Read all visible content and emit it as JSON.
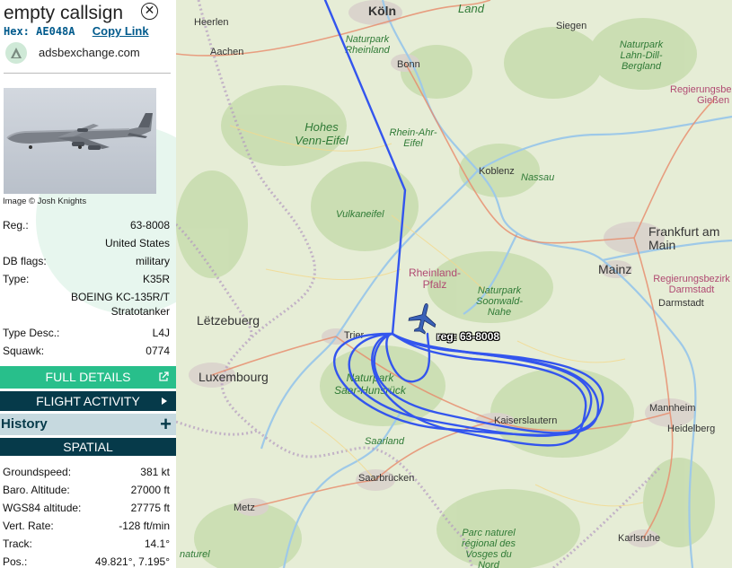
{
  "aircraft": {
    "callsign": "empty callsign",
    "hex_label": "Hex:",
    "hex": "AE048A",
    "copy_link": "Copy Link",
    "site": "adsbexchange.com",
    "image_credit": "Image © Josh Knights"
  },
  "details": [
    {
      "key": "Reg.:",
      "value": "63-8008"
    },
    {
      "key": "",
      "value": "United States"
    },
    {
      "key": "DB flags:",
      "value": "military"
    },
    {
      "key": "Type:",
      "value": "K35R"
    },
    {
      "key": "",
      "value": "BOEING KC-135R/T"
    },
    {
      "key": "",
      "value": "Stratotanker"
    },
    {
      "key": "Type Desc.:",
      "value": "L4J"
    },
    {
      "key": "Squawk:",
      "value": "0774"
    }
  ],
  "buttons": {
    "full_details": "FULL DETAILS",
    "flight_activity": "FLIGHT ACTIVITY",
    "history": "History",
    "spatial": "SPATIAL"
  },
  "spatial": [
    {
      "key": "Groundspeed:",
      "value": "381 kt"
    },
    {
      "key": "Baro. Altitude:",
      "value": "27000 ft"
    },
    {
      "key": "WGS84 altitude:",
      "value": "27775 ft"
    },
    {
      "key": "Vert. Rate:",
      "value": "-128 ft/min"
    },
    {
      "key": "Track:",
      "value": "14.1°"
    },
    {
      "key": "Pos.:",
      "value": "49.821°, 7.195°"
    }
  ],
  "map": {
    "aircraft_label": "reg: 63-8008",
    "track_color": "#3355ee",
    "aircraft_color": "#3a62b8",
    "cities": [
      "Heerlen",
      "Köln",
      "Siegen",
      "Aachen",
      "Bonn",
      "Koblenz",
      "Frankfurt am Main",
      "Mainz",
      "Darmstadt",
      "Trier",
      "Lëtzebuerg",
      "Luxembourg",
      "Mannheim",
      "Heidelberg",
      "Kaiserslautern",
      "Saarbrücken",
      "Metz",
      "Karlsruhe",
      "Gießen"
    ],
    "parks": [
      "Land",
      "Naturpark Rheinland",
      "Naturpark Lahn-Dill-Bergland",
      "Hohes Venn-Eifel",
      "Rhein-Ahr-Eifel",
      "Nassau",
      "Vulkaneifel",
      "Naturpark Soonwald-Nahe",
      "Naturpark Saar-Hunsrück",
      "Saarland",
      "Parc naturel régional des Vosges du Nord",
      "naturel"
    ],
    "regions": [
      "Regierungsbez",
      "Regierungsbezirk Darmstadt",
      "Rheinland-Pfalz"
    ]
  }
}
